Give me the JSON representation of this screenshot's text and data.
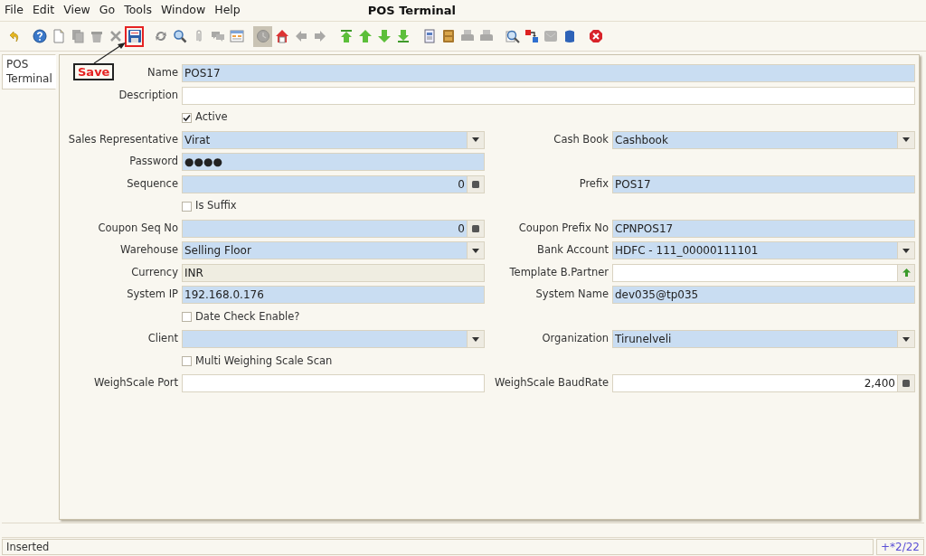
{
  "menu": [
    "File",
    "Edit",
    "View",
    "Go",
    "Tools",
    "Window",
    "Help"
  ],
  "window": {
    "title": "POS Terminal"
  },
  "toolbar": [
    [
      {
        "kind": "undo",
        "disabled": false,
        "pressed": false,
        "annotated": false
      }
    ],
    [
      {
        "kind": "help",
        "disabled": false,
        "pressed": false,
        "annotated": false
      },
      {
        "kind": "new",
        "disabled": false,
        "pressed": false,
        "annotated": false
      },
      {
        "kind": "copy",
        "disabled": true,
        "pressed": false,
        "annotated": false
      },
      {
        "kind": "delete",
        "disabled": true,
        "pressed": false,
        "annotated": false
      },
      {
        "kind": "delete_selection",
        "disabled": true,
        "pressed": false,
        "annotated": false
      },
      {
        "kind": "save",
        "disabled": false,
        "pressed": false,
        "annotated": true
      }
    ],
    [
      {
        "kind": "refresh",
        "disabled": false,
        "pressed": false,
        "annotated": false
      },
      {
        "kind": "find",
        "disabled": false,
        "pressed": false,
        "annotated": false
      },
      {
        "kind": "attach",
        "disabled": true,
        "pressed": false,
        "annotated": false
      },
      {
        "kind": "chat",
        "disabled": true,
        "pressed": false,
        "annotated": false
      },
      {
        "kind": "grid",
        "disabled": false,
        "pressed": false,
        "annotated": false
      }
    ],
    [
      {
        "kind": "history",
        "disabled": true,
        "pressed": true,
        "annotated": false
      },
      {
        "kind": "home",
        "disabled": false,
        "pressed": false,
        "annotated": false
      },
      {
        "kind": "prev",
        "disabled": true,
        "pressed": false,
        "annotated": false
      },
      {
        "kind": "next",
        "disabled": true,
        "pressed": false,
        "annotated": false
      }
    ],
    [
      {
        "kind": "first",
        "disabled": false,
        "pressed": false,
        "annotated": false
      },
      {
        "kind": "up",
        "disabled": false,
        "pressed": false,
        "annotated": false
      },
      {
        "kind": "down",
        "disabled": false,
        "pressed": false,
        "annotated": false
      },
      {
        "kind": "last",
        "disabled": false,
        "pressed": false,
        "annotated": false
      }
    ],
    [
      {
        "kind": "report",
        "disabled": false,
        "pressed": false,
        "annotated": false
      },
      {
        "kind": "archive",
        "disabled": false,
        "pressed": false,
        "annotated": false
      },
      {
        "kind": "print_preview",
        "disabled": true,
        "pressed": false,
        "annotated": false
      },
      {
        "kind": "print",
        "disabled": true,
        "pressed": false,
        "annotated": false
      }
    ],
    [
      {
        "kind": "zoom_across",
        "disabled": false,
        "pressed": false,
        "annotated": false
      },
      {
        "kind": "workflow",
        "disabled": false,
        "pressed": false,
        "annotated": false
      },
      {
        "kind": "request",
        "disabled": true,
        "pressed": false,
        "annotated": false
      },
      {
        "kind": "product_info",
        "disabled": false,
        "pressed": false,
        "annotated": false
      }
    ],
    [
      {
        "kind": "close",
        "disabled": false,
        "pressed": false,
        "annotated": false
      }
    ]
  ],
  "callout": {
    "text": "Save"
  },
  "tabs": [
    {
      "label": "POS Terminal",
      "selected": true
    }
  ],
  "rows": [
    {
      "left": {
        "kind": "text",
        "label": "Name",
        "value": "POS17",
        "mandatory": true,
        "readonly": false,
        "wide": true
      }
    },
    {
      "left": {
        "kind": "text",
        "label": "Description",
        "mandatory": false,
        "readonly": false,
        "wide": true
      }
    },
    {
      "left": {
        "kind": "checkbox",
        "label": "Active",
        "checked": true
      }
    },
    {
      "left": {
        "kind": "combo",
        "label": "Sales Representative",
        "value": "Virat",
        "mandatory": true,
        "readonly": false
      },
      "right": {
        "kind": "combo",
        "label": "Cash Book",
        "value": "Cashbook",
        "mandatory": true,
        "readonly": false
      }
    },
    {
      "left": {
        "kind": "text",
        "label": "Password",
        "value": "●●●●",
        "mandatory": true,
        "readonly": false
      }
    },
    {
      "left": {
        "kind": "number",
        "label": "Sequence",
        "value": "0",
        "mandatory": true,
        "readonly": false
      },
      "right": {
        "kind": "text",
        "label": "Prefix",
        "value": "POS17",
        "mandatory": true,
        "readonly": false
      }
    },
    {
      "left": {
        "kind": "checkbox",
        "label": "Is Suffix",
        "checked": false
      }
    },
    {
      "left": {
        "kind": "number",
        "label": "Coupon Seq No",
        "value": "0",
        "mandatory": true,
        "readonly": false
      },
      "right": {
        "kind": "text",
        "label": "Coupon Prefix No",
        "value": "CPNPOS17",
        "mandatory": true,
        "readonly": false
      }
    },
    {
      "left": {
        "kind": "combo",
        "label": "Warehouse",
        "value": "Selling Floor",
        "mandatory": true,
        "readonly": false
      },
      "right": {
        "kind": "combo",
        "label": "Bank Account",
        "value": "HDFC - 111_00000111101",
        "mandatory": true,
        "readonly": false
      }
    },
    {
      "left": {
        "kind": "text",
        "label": "Currency",
        "value": "INR",
        "mandatory": false,
        "readonly": true
      },
      "right": {
        "kind": "search",
        "label": "Template B.Partner",
        "mandatory": false,
        "readonly": false
      }
    },
    {
      "left": {
        "kind": "text",
        "label": "System IP",
        "value": "192.168.0.176",
        "mandatory": true,
        "readonly": false
      },
      "right": {
        "kind": "text",
        "label": "System Name",
        "value": "dev035@tp035",
        "mandatory": true,
        "readonly": false
      }
    },
    {
      "left": {
        "kind": "checkbox",
        "label": "Date Check Enable?",
        "checked": false
      }
    },
    {
      "left": {
        "kind": "combo",
        "label": "Client",
        "mandatory": true,
        "readonly": false
      },
      "right": {
        "kind": "combo",
        "label": "Organization",
        "value": "Tirunelveli",
        "mandatory": true,
        "readonly": false
      }
    },
    {
      "left": {
        "kind": "checkbox",
        "label": "Multi Weighing Scale Scan",
        "checked": false
      }
    },
    {
      "left": {
        "kind": "text",
        "label": "WeighScale Port",
        "mandatory": false,
        "readonly": false
      },
      "right": {
        "kind": "number",
        "label": "WeighScale BaudRate",
        "value": "2,400",
        "mandatory": false,
        "readonly": false
      }
    }
  ],
  "status_bar": {
    "message": "Inserted",
    "record": "+*2/22"
  }
}
